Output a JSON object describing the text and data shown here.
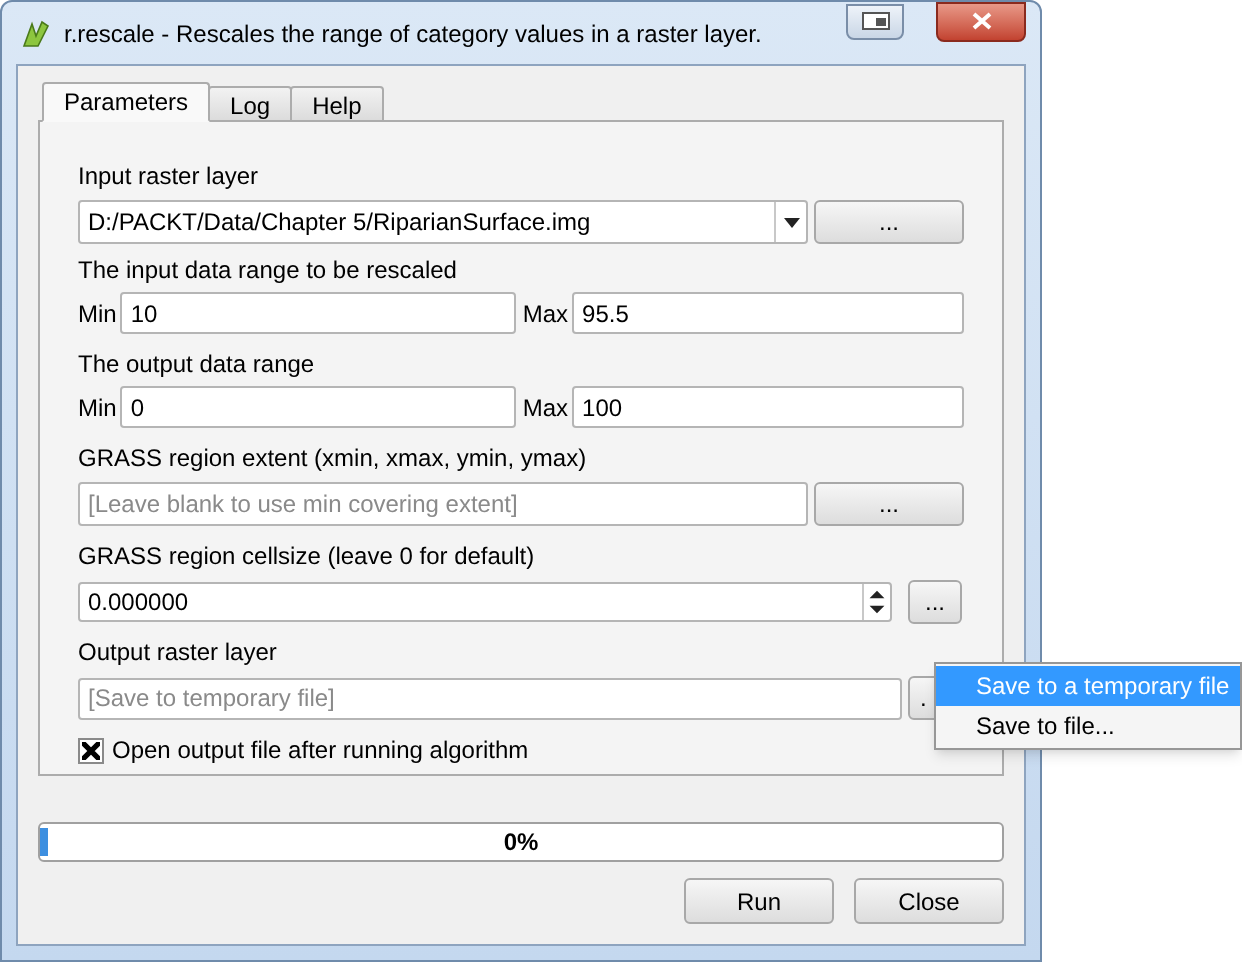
{
  "window": {
    "title": "r.rescale - Rescales the range of category values in a raster layer."
  },
  "tabs": [
    {
      "label": "Parameters",
      "selected": true
    },
    {
      "label": "Log",
      "selected": false
    },
    {
      "label": "Help",
      "selected": false
    }
  ],
  "parameters": {
    "input_raster": {
      "label": "Input raster layer",
      "value": "D:/PACKT/Data/Chapter 5/RiparianSurface.img",
      "button": "..."
    },
    "input_range": {
      "label": "The input data range to be rescaled",
      "min_label": "Min",
      "min": "10",
      "max_label": "Max",
      "max": "95.5"
    },
    "output_range": {
      "label": "The output data range",
      "min_label": "Min",
      "min": "0",
      "max_label": "Max",
      "max": "100"
    },
    "region_extent": {
      "label": "GRASS region extent (xmin, xmax, ymin, ymax)",
      "placeholder": "[Leave blank to use min covering extent]",
      "button": "..."
    },
    "region_cellsize": {
      "label": "GRASS region cellsize (leave 0 for default)",
      "value": "0.000000",
      "button": "..."
    },
    "output_raster": {
      "label": "Output raster layer",
      "placeholder": "[Save to temporary file]",
      "button": "."
    },
    "open_output": {
      "label": "Open output file after running algorithm",
      "checked": true
    }
  },
  "context_menu": [
    {
      "label": "Save to a temporary file",
      "selected": true
    },
    {
      "label": "Save to file...",
      "selected": false
    }
  ],
  "progress": {
    "level": 0.008,
    "text": "0%"
  },
  "buttons": [
    "Run",
    "Close"
  ]
}
